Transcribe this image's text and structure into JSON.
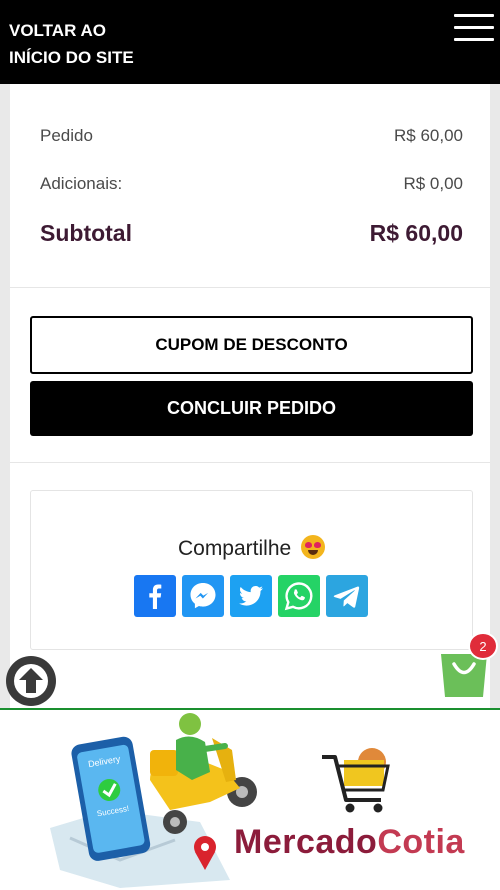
{
  "header": {
    "back_link_line1": "VOLTAR AO",
    "back_link_line2": "INÍCIO DO SITE",
    "menu_icon": "hamburger-icon"
  },
  "summary": {
    "order_label": "Pedido",
    "order_value": "R$ 60,00",
    "extras_label": "Adicionais:",
    "extras_value": "R$ 0,00",
    "subtotal_label": "Subtotal",
    "subtotal_value": "R$ 60,00"
  },
  "actions": {
    "coupon_label": "CUPOM DE DESCONTO",
    "finish_label": "CONCLUIR PEDIDO"
  },
  "share": {
    "title": "Compartilhe",
    "emoji": "heart-eyes-emoji",
    "networks": [
      "facebook",
      "messenger",
      "twitter",
      "whatsapp",
      "telegram"
    ]
  },
  "floating": {
    "cart_count": "2",
    "scroll_icon": "arrow-up-icon",
    "cart_icon": "shopping-bag-icon"
  },
  "banner": {
    "phone_text1": "Delivery",
    "phone_text2": "Success!",
    "brand_part1": "Mercado",
    "brand_part2": "Cotia"
  },
  "colors": {
    "topbar": "#000000",
    "subtotal": "#3d1a33",
    "facebook": "#1877f2",
    "messenger": "#2196f3",
    "twitter": "#1da1f2",
    "whatsapp": "#25d366",
    "telegram": "#2ca5e0",
    "cart_green": "#6bbf59",
    "badge_red": "#e02c3a",
    "brand_dark": "#8c1c3b"
  }
}
